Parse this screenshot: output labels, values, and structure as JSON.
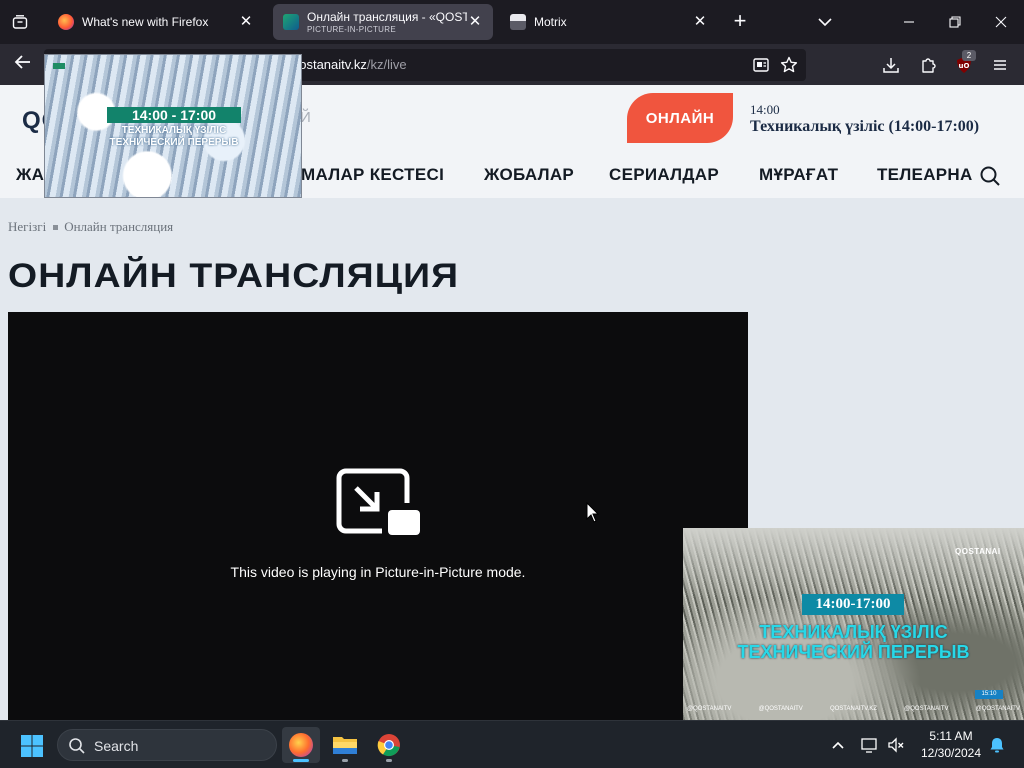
{
  "browser": {
    "tabs": [
      {
        "title": "What's new with Firefox",
        "subtitle": ""
      },
      {
        "title": "Онлайн трансляция - «QOSTA",
        "subtitle": "PICTURE-IN-PICTURE"
      },
      {
        "title": "Motrix",
        "subtitle": ""
      }
    ],
    "new_tab": "+",
    "url_host": "qostanaitv.kz",
    "url_path": "/kz/live",
    "extension_badge": "2"
  },
  "site": {
    "logo_text": "QO",
    "logo_tail": "Й",
    "online_button": "ОНЛАЙН",
    "now_playing_time": "14:00",
    "now_playing_title": "Техникалық үзіліс (14:00-17:00)",
    "menu": [
      "ЖА",
      "МАЛАР КЕСТЕСІ",
      "ЖОБАЛАР",
      "СЕРИАЛДАР",
      "МҰРАҒАТ",
      "ТЕЛЕАРНА"
    ],
    "breadcrumb": {
      "home": "Негізгі",
      "current": "Онлайн трансляция"
    },
    "page_title": "ОНЛАЙН ТРАНСЛЯЦИЯ",
    "pip_message": "This video is playing in Picture-in-Picture mode."
  },
  "tab_preview": {
    "time": "14:00 - 17:00",
    "line1": "ТЕХНИКАЛЫҚ ҮЗІЛІС",
    "line2": "ТЕХНИЧЕСКИЙ ПЕРЕРЫВ"
  },
  "pip_window": {
    "channel_logo": "QOSTANAI",
    "time": "14:00-17:00",
    "line1": "ТЕХНИКАЛЫҚ ҮЗІЛІС",
    "line2": "ТЕХНИЧЕСКИЙ ПЕРЕРЫВ",
    "clock": "15:10",
    "social": [
      "@QOSTANAITV",
      "@QOSTANAITV",
      "QOSTANAITV.KZ",
      "@QOSTANAITV",
      "@QOSTANAITV"
    ]
  },
  "taskbar": {
    "search_label": "Search",
    "time": "5:11 AM",
    "date": "12/30/2024"
  },
  "colors": {
    "accent_online": "#f0553e",
    "tab_active": "#42414d",
    "pip_banner": "#0e8aa5",
    "pip_text": "#27d8e8"
  }
}
